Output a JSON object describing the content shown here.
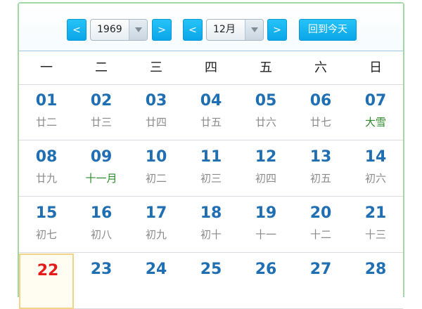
{
  "nav": {
    "prev_year": "<",
    "next_year": ">",
    "prev_month": "<",
    "next_month": ">",
    "year_value": "1969",
    "month_value": "12月",
    "today_label": "回到今天"
  },
  "weekdays": [
    "一",
    "二",
    "三",
    "四",
    "五",
    "六",
    "日"
  ],
  "weeks": [
    [
      {
        "num": "01",
        "lunar": "廿二"
      },
      {
        "num": "02",
        "lunar": "廿三"
      },
      {
        "num": "03",
        "lunar": "廿四"
      },
      {
        "num": "04",
        "lunar": "廿五"
      },
      {
        "num": "05",
        "lunar": "廿六"
      },
      {
        "num": "06",
        "lunar": "廿七"
      },
      {
        "num": "07",
        "lunar": "大雪"
      }
    ],
    [
      {
        "num": "08",
        "lunar": "廿九"
      },
      {
        "num": "09",
        "lunar": "十一月"
      },
      {
        "num": "10",
        "lunar": "初二"
      },
      {
        "num": "11",
        "lunar": "初三"
      },
      {
        "num": "12",
        "lunar": "初四"
      },
      {
        "num": "13",
        "lunar": "初五"
      },
      {
        "num": "14",
        "lunar": "初六"
      }
    ],
    [
      {
        "num": "15",
        "lunar": "初七"
      },
      {
        "num": "16",
        "lunar": "初八"
      },
      {
        "num": "17",
        "lunar": "初九"
      },
      {
        "num": "18",
        "lunar": "初十"
      },
      {
        "num": "19",
        "lunar": "十一"
      },
      {
        "num": "20",
        "lunar": "十二"
      },
      {
        "num": "21",
        "lunar": "十三"
      }
    ],
    [
      {
        "num": "22",
        "lunar": ""
      },
      {
        "num": "23",
        "lunar": ""
      },
      {
        "num": "24",
        "lunar": ""
      },
      {
        "num": "25",
        "lunar": ""
      },
      {
        "num": "26",
        "lunar": ""
      },
      {
        "num": "27",
        "lunar": ""
      },
      {
        "num": "28",
        "lunar": ""
      }
    ]
  ],
  "colors": {
    "accent": "#0aa6e8",
    "date_number": "#1f6fb2",
    "today_number": "#e51b1b",
    "solar_term_text": "#2b8a2b",
    "lunar_text": "#8a8a8a"
  }
}
